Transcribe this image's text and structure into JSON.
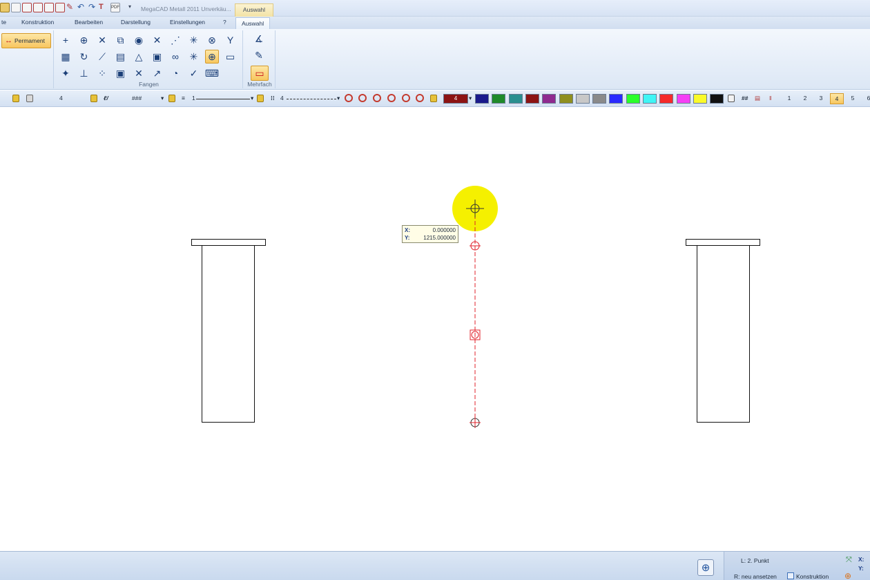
{
  "window": {
    "title": "MegaCAD Metall 2011  Unverkäu...",
    "contextual_tab_header": "Auswahl"
  },
  "tabs": [
    {
      "label": "te"
    },
    {
      "label": "Konstruktion"
    },
    {
      "label": "Bearbeiten"
    },
    {
      "label": "Darstellung"
    },
    {
      "label": "Einstellungen"
    },
    {
      "label": "?"
    },
    {
      "label": "Auswahl",
      "active": true
    }
  ],
  "ribbon": {
    "permanent_button": "Permament",
    "fangen_label": "Fangen",
    "mehrfach_label": "Mehrfach",
    "fangen_icons": [
      "add-point-icon",
      "zoom-snap-icon",
      "intersection-icon",
      "rectangle-snap-icon",
      "arc-snap-icon",
      "cross-line-icon",
      "endpoints-icon",
      "star-snap-icon",
      "circle-center-icon",
      "xy-icon",
      "grid-icon",
      "curve-snap-icon",
      "tangent-icon",
      "layer-snap-icon",
      "triangle-snap-icon",
      "frame-snap-icon",
      "double-circle-icon",
      "asterisk-icon",
      "center-target-icon",
      "box-snap-icon",
      "plus-star-icon",
      "perpendicular-icon",
      "multi-point-icon",
      "screen-snap-icon",
      "x-snap-icon",
      "polyline-icon",
      "radius-snap-icon",
      "check-snap-icon",
      "keyboard-icon"
    ],
    "mehrfach_icons": [
      "angle-icon",
      "pencil-icon",
      "multiple-select-icon"
    ]
  },
  "format_toolbar": {
    "layer": "4",
    "pen_pattern": "###",
    "line_width": "1",
    "line_type": "4",
    "active_color_value": "4",
    "hash_label": "##",
    "colors": [
      "#1a1a8c",
      "#1f8a2a",
      "#2a8f8f",
      "#8c1414",
      "#8f2a8f",
      "#8f8f1f",
      "#c8c8c8",
      "#8a8a8a",
      "#2a2aff",
      "#2aff2a",
      "#3ff5f5",
      "#f52a2a",
      "#f53ff5",
      "#fafa2a",
      "#111111"
    ],
    "active_color": "#8c1414",
    "pages": [
      "1",
      "2",
      "3",
      "4",
      "5",
      "6"
    ],
    "active_page": "4"
  },
  "canvas": {
    "coordinate_display": {
      "x_label": "X:",
      "x_value": "0.000000",
      "y_label": "Y:",
      "y_value": "1215.000000"
    }
  },
  "status_bar": {
    "left_prompt": "L: 2. Punkt",
    "right_prompt": "R: neu ansetzen",
    "mode": "Konstruktion",
    "x_label": "X:",
    "y_label": "Y:"
  }
}
